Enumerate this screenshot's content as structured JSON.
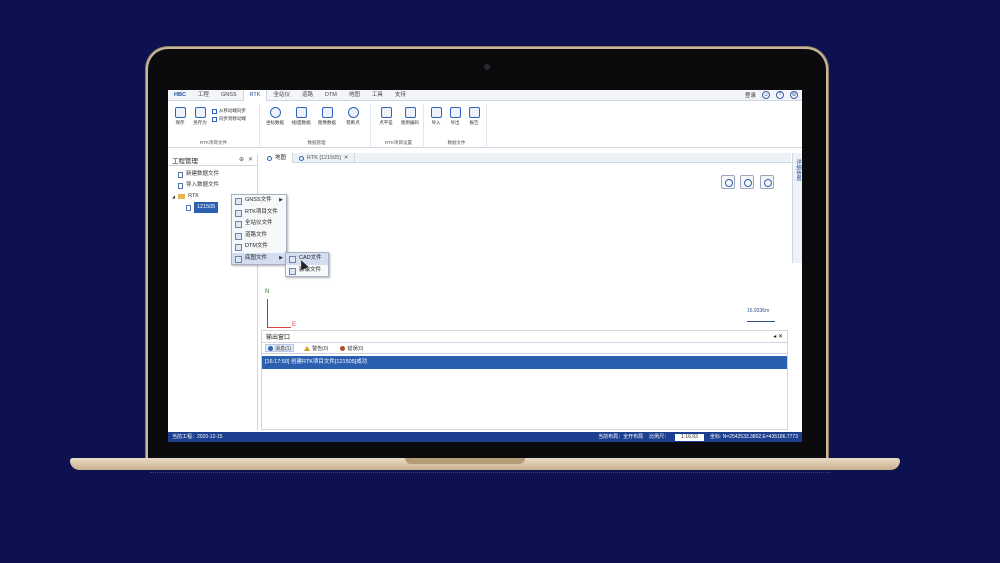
{
  "app": {
    "brand": "HBC",
    "tabs": [
      "工程",
      "GNSS",
      "RTK",
      "全站仪",
      "道路",
      "DTM",
      "地图",
      "工具",
      "支持"
    ],
    "active_tab": "RTK",
    "login": "登录"
  },
  "ribbon": {
    "groups": [
      {
        "name": "RTK项目文件",
        "buttons": [
          "保存",
          "另存为"
        ],
        "small": [
          "从移动端同步",
          "同步到移动端"
        ]
      },
      {
        "name": "数据管理",
        "buttons": [
          "坐标数据",
          "线/面数据",
          "图像数据",
          "错断点"
        ]
      },
      {
        "name": "RTK项目设置",
        "buttons": [
          "点平差",
          "图例编码"
        ]
      },
      {
        "name": "数据文件",
        "buttons": [
          "导入",
          "导出",
          "报告"
        ]
      }
    ]
  },
  "left_panel": {
    "title": "工程管理",
    "pin": "⊕",
    "close": "✕",
    "items": [
      "新建数据文件",
      "导入数据文件",
      "RTK",
      "121505"
    ]
  },
  "context_menu": {
    "items": [
      "GNSS文件",
      "RTK项目文件",
      "全站仪文件",
      "道路文件",
      "DTM文件",
      "底图文件"
    ],
    "submenu": [
      "CAD文件",
      "影像文件"
    ]
  },
  "doc_tabs": [
    "地图",
    "RTK [121505]"
  ],
  "map": {
    "north": "N",
    "east": "E",
    "scale": "16.9336m"
  },
  "side_tab": "详细信息",
  "output": {
    "title": "输出窗口",
    "tabs": [
      "消息(1)",
      "警告(0)",
      "错误(0)"
    ],
    "log": "[16:17:50] 创建RTK项目文件[121505]成功"
  },
  "status": {
    "project": "当前工程：2020-12-15",
    "layout": "当前布局：全开布局",
    "scale_label": "比例尺：",
    "scale_value": "1:16.93",
    "coords": "坐标: N=2542533.3802,E=435186.7773"
  }
}
